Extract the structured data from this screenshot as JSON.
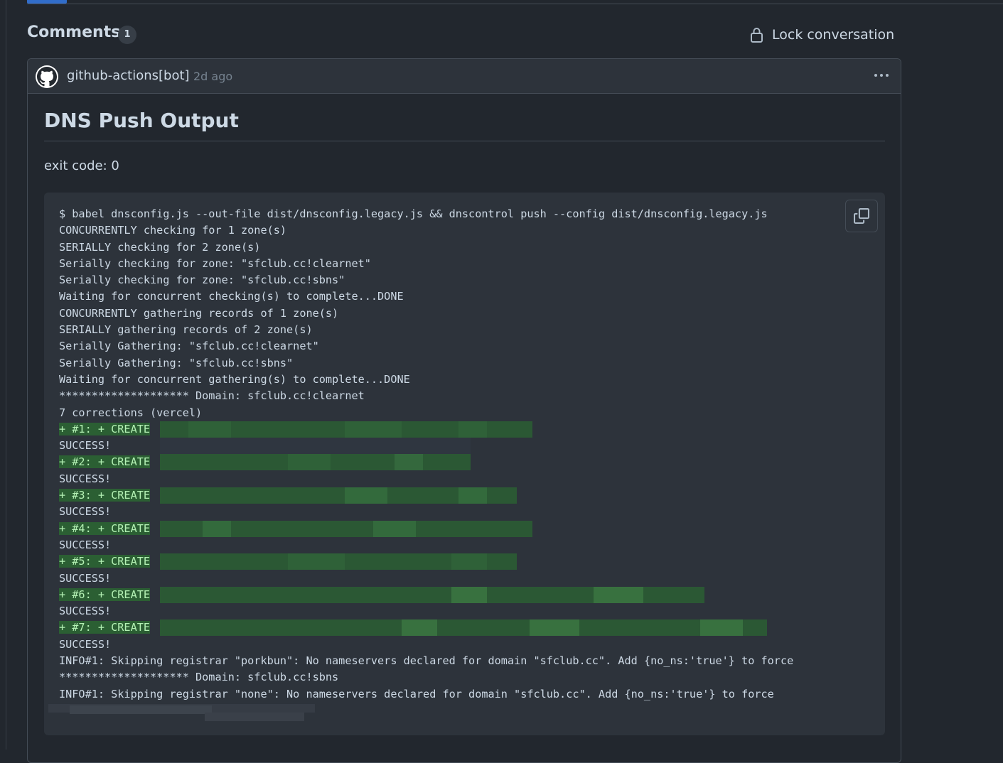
{
  "comments_section": {
    "title": "Comments",
    "count": "1",
    "lock_label": "Lock conversation"
  },
  "comment": {
    "author": "github-actions[bot]",
    "timestamp": "2d ago",
    "heading": "DNS Push Output",
    "exit_code": "exit code: 0",
    "log_lines": [
      "$ babel dnsconfig.js --out-file dist/dnsconfig.legacy.js && dnscontrol push --config dist/dnsconfig.legacy.js",
      "CONCURRENTLY checking for 1 zone(s)",
      "SERIALLY checking for 2 zone(s)",
      "Serially checking for zone: \"sfclub.cc!clearnet\"",
      "Serially checking for zone: \"sfclub.cc!sbns\"",
      "Waiting for concurrent checking(s) to complete...DONE",
      "CONCURRENTLY gathering records of 1 zone(s)",
      "SERIALLY gathering records of 2 zone(s)",
      "Serially Gathering: \"sfclub.cc!clearnet\"",
      "Serially Gathering: \"sfclub.cc!sbns\"",
      "Waiting for concurrent gathering(s) to complete...DONE",
      "******************** Domain: sfclub.cc!clearnet",
      "7 corrections (vercel)",
      "+ #1: + CREATE",
      "SUCCESS!",
      "+ #2: + CREATE",
      "SUCCESS!",
      "+ #3: + CREATE",
      "SUCCESS!",
      "+ #4: + CREATE",
      "SUCCESS!",
      "+ #5: + CREATE",
      "SUCCESS!",
      "+ #6: + CREATE",
      "SUCCESS!",
      "+ #7: + CREATE",
      "SUCCESS!",
      "INFO#1: Skipping registrar \"porkbun\": No nameservers declared for domain \"sfclub.cc\". Add {no_ns:'true'} to force",
      "******************** Domain: sfclub.cc!sbns",
      "INFO#1: Skipping registrar \"none\": No nameservers declared for domain \"sfclub.cc\". Add {no_ns:'true'} to force"
    ]
  },
  "icons": {
    "lock": "lock-icon",
    "avatar": "github-mark-icon",
    "menu": "kebab-horizontal-icon",
    "copy": "copy-icon"
  },
  "colors": {
    "background": "#22272e",
    "surface": "#2d333b",
    "border": "#444c56",
    "diff_add_bg": "#2b5f33",
    "diff_add_text": "#b4f1b4"
  }
}
